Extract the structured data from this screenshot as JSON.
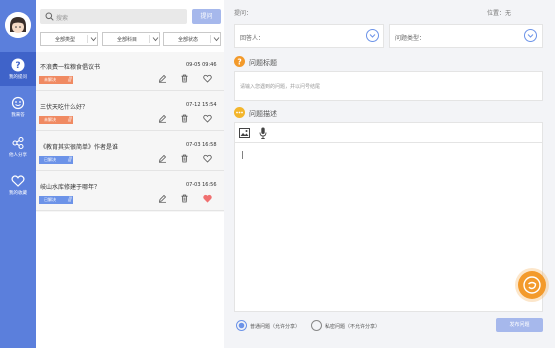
{
  "nav": {
    "items": [
      {
        "label": "我的提问",
        "icon": "question-icon"
      },
      {
        "label": "我来答",
        "icon": "answer-icon"
      },
      {
        "label": "他人分享",
        "icon": "share-icon"
      },
      {
        "label": "我的收藏",
        "icon": "heart-icon"
      }
    ]
  },
  "list": {
    "search_placeholder": "搜索",
    "ask_button": "提问",
    "filters": [
      "全部类型",
      "全部科目",
      "全部状态"
    ],
    "rows": [
      {
        "title": "不浪费一粒粮食倡议书",
        "date": "09-05 09:46",
        "status": "未解决",
        "favorited": false
      },
      {
        "title": "三伏天吃什么好？",
        "date": "07-12 15:54",
        "status": "未解决",
        "favorited": false
      },
      {
        "title": "《教育其实很简单》作者是谁",
        "date": "07-03 16:58",
        "status": "已解决",
        "favorited": false
      },
      {
        "title": "岐山水库修建于哪年？",
        "date": "07-03 16:56",
        "status": "已解决",
        "favorited": true
      }
    ]
  },
  "form": {
    "question_label": "提问：",
    "position_label": "位置：无",
    "answerer_label": "回答人：",
    "question_type_label": "问题类型：",
    "title_section": "问题标题",
    "title_placeholder": "请输入您遇到的问题，并以问号结尾",
    "desc_section": "问题描述",
    "cursor": "|",
    "radio_normal": "普通问题（允许分享）",
    "radio_private": "私密问题（不允许分享）",
    "publish_button": "发布问题"
  },
  "colors": {
    "nav_bg": "#5b7fdc",
    "accent": "#6c93e8",
    "unsolved": "#f08a62",
    "solved": "#6c93e8",
    "fab": "#f39a2b"
  }
}
